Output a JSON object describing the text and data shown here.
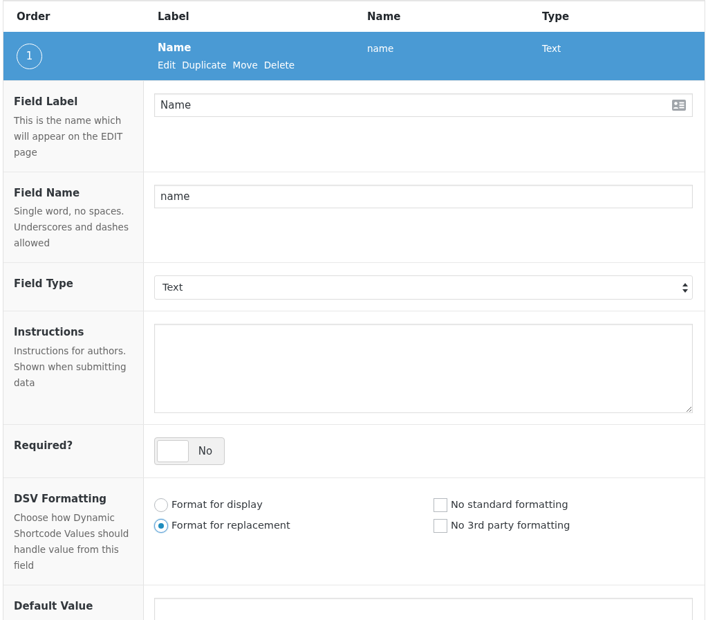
{
  "columns": [
    "Order",
    "Label",
    "Name",
    "Type"
  ],
  "field_row": {
    "order": "1",
    "label": "Name",
    "actions": [
      "Edit",
      "Duplicate",
      "Move",
      "Delete"
    ],
    "name": "name",
    "type": "Text",
    "selected": true
  },
  "settings": [
    {
      "kind": "text",
      "label": "Field Label",
      "description": "This is the name which will appear on the EDIT page",
      "value": "Name",
      "has_icon": true
    },
    {
      "kind": "text",
      "label": "Field Name",
      "description": "Single word, no spaces. Underscores and dashes allowed",
      "value": "name"
    },
    {
      "kind": "select",
      "label": "Field Type",
      "value": "Text"
    },
    {
      "kind": "textarea",
      "label": "Instructions",
      "description": "Instructions for authors. Shown when submitting data"
    },
    {
      "kind": "toggle",
      "label": "Required?",
      "on": false,
      "state_text": "No"
    },
    {
      "kind": "format",
      "label": "DSV Formatting",
      "description": "Choose how Dynamic Shortcode Values should handle value from this field",
      "radios": [
        {
          "label": "Format for display",
          "selected": false
        },
        {
          "label": "Format for replacement",
          "selected": true
        }
      ],
      "checkboxes": [
        {
          "label": "No standard formatting",
          "checked": false
        },
        {
          "label": "No 3rd party formatting",
          "checked": false
        }
      ]
    },
    {
      "kind": "text",
      "label": "Default Value"
    }
  ]
}
